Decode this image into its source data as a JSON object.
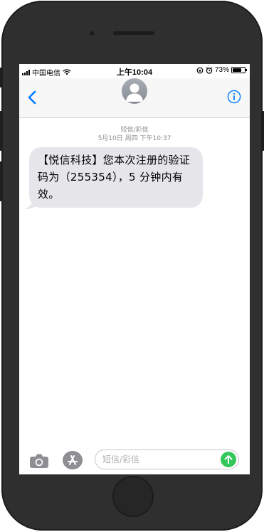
{
  "status_bar": {
    "carrier": "中国电信",
    "time": "上午10:04",
    "battery_percent": "73%",
    "battery_level": 0.73,
    "icons": [
      "signal-icon",
      "wifi-icon",
      "orientation-lock-icon",
      "alarm-icon",
      "battery-icon"
    ]
  },
  "nav": {
    "back_icon": "chevron-left-icon",
    "avatar_icon": "contact-avatar-icon",
    "info_icon": "info-icon",
    "accent_color": "#007aff"
  },
  "thread": {
    "service_label": "短信/彩信",
    "timestamp": "5月10日 周四 下午10:37",
    "messages": [
      {
        "direction": "incoming",
        "text": "【悦信科技】您本次注册的验证码为（255354），5 分钟内有效。"
      }
    ]
  },
  "composer": {
    "camera_icon": "camera-icon",
    "apps_icon": "app-store-icon",
    "placeholder": "短信/彩信",
    "send_icon": "send-arrow-icon",
    "send_color": "#34c759"
  }
}
